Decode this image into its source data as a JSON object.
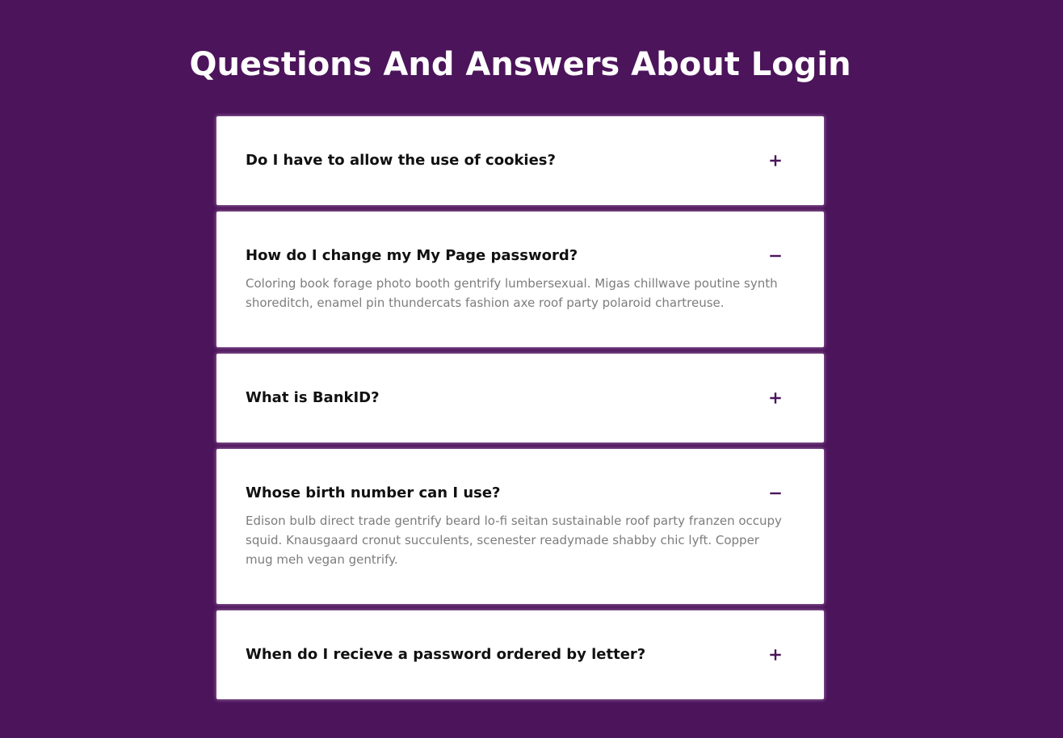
{
  "page": {
    "title": "Questions And Answers About Login"
  },
  "colors": {
    "background": "#4c145a",
    "accent": "#4c145a",
    "question": "#111111",
    "answer": "#7d7d7d"
  },
  "faq": [
    {
      "question": "Do I have to allow the use of cookies?",
      "expanded": false,
      "toggle_icon": "plus-icon",
      "answer": ""
    },
    {
      "question": "How do I change my My Page password?",
      "expanded": true,
      "toggle_icon": "minus-icon",
      "answer": "Coloring book forage photo booth gentrify lumbersexual. Migas chillwave poutine synth shoreditch, enamel pin thundercats fashion axe roof party polaroid chartreuse."
    },
    {
      "question": "What is BankID?",
      "expanded": false,
      "toggle_icon": "plus-icon",
      "answer": ""
    },
    {
      "question": "Whose birth number can I use?",
      "expanded": true,
      "toggle_icon": "minus-icon",
      "answer": "Edison bulb direct trade gentrify beard lo-fi seitan sustainable roof party franzen occupy squid. Knausgaard cronut succulents, scenester readymade shabby chic lyft. Copper mug meh vegan gentrify."
    },
    {
      "question": "When do I recieve a password ordered by letter?",
      "expanded": false,
      "toggle_icon": "plus-icon",
      "answer": ""
    }
  ]
}
